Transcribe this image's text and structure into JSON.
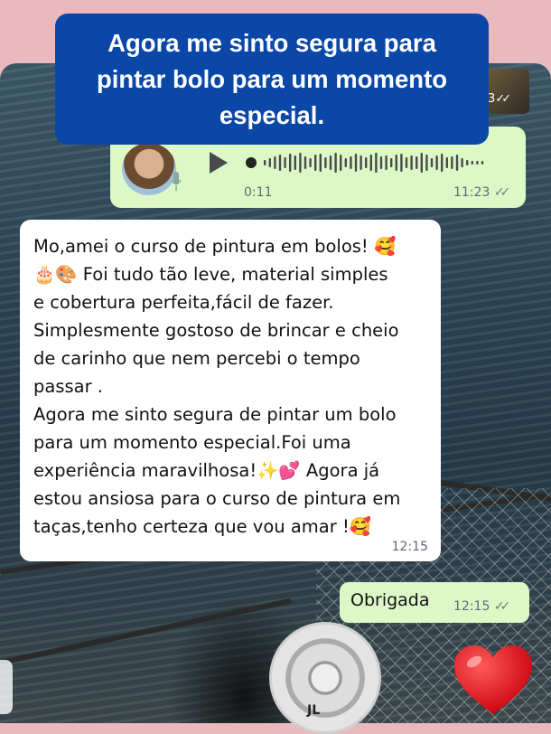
{
  "banner": {
    "title": "Agora me sinto segura para pintar bolo para um momento especial."
  },
  "corner_preview": {
    "time_fragment": "3"
  },
  "audio_message": {
    "duration": "0:11",
    "time": "11:23"
  },
  "message": {
    "text": "Mo,amei o curso de pintura em bolos! 🥰\n🎂🎨 Foi tudo tão leve, material simples\ne cobertura perfeita,fácil de fazer.\nSimplesmente gostoso de brincar e cheio\nde carinho que nem percebi o tempo\npassar .\nAgora me sinto segura de pintar um bolo\npara um momento especial.Foi uma\nexperiência maravilhosa!✨💕 Agora já\nestou ansiosa para o curso de pintura em\ntaças,tenho certeza que vou amar !🥰",
    "time": "12:15"
  },
  "reply": {
    "text": "Obrigada",
    "time": "12:15"
  },
  "speaker_brand": "JL",
  "colors": {
    "banner": "#0a47a7",
    "outgoing_bubble": "#dcf8c6",
    "incoming_bubble": "#ffffff",
    "heart": "#e0101a",
    "page_background": "#e9b9bd"
  },
  "icons": [
    "play-icon",
    "mic-icon",
    "double-check-icon",
    "heart-icon"
  ]
}
